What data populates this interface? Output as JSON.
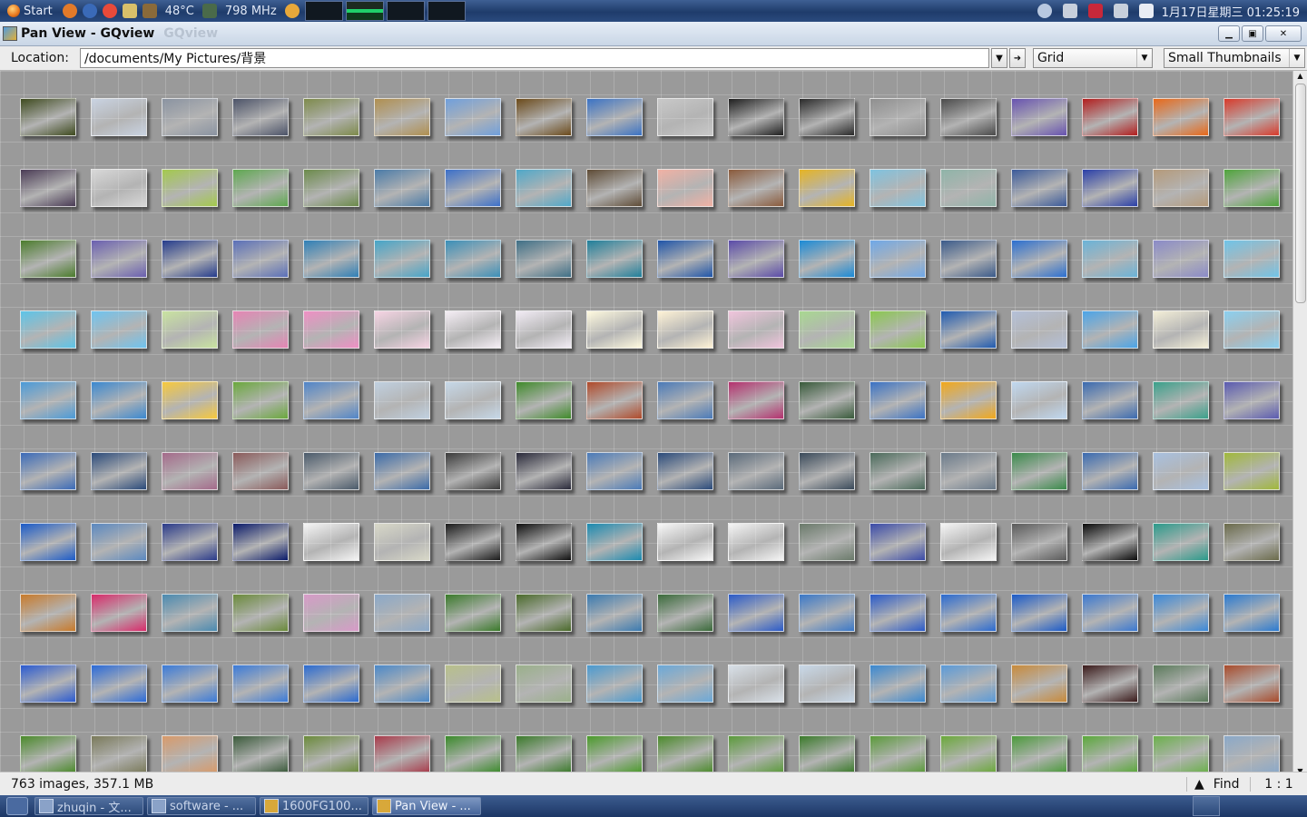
{
  "topbar": {
    "start_label": "Start",
    "temperature": "48°C",
    "cpu_freq": "798 MHz",
    "datetime": "1月17日星期三 01:25:19"
  },
  "window": {
    "title": "Pan View - GQview",
    "title_ghost": "GQview",
    "location_label": "Location:",
    "location_value": "/documents/My Pictures/背景",
    "layout_select": "Grid",
    "size_select": "Small Thumbnails"
  },
  "status": {
    "summary": "763 images, 357.1 MB",
    "find_label": "Find",
    "zoom": "1 : 1"
  },
  "taskbar": {
    "items": [
      {
        "label": "zhuqin - 文..."
      },
      {
        "label": "software - ..."
      },
      {
        "label": "1600FG100..."
      },
      {
        "label": "Pan View - ..."
      }
    ]
  },
  "colors": {
    "grid_background": "#9a9a9a",
    "taskbar": "#1c3665"
  },
  "thumbnails": [
    [
      "#3e4a1e",
      "#c9d3e2",
      "#8a93a1",
      "#4c5368",
      "#7d8a4a",
      "#b08f4f",
      "#6f9fdc",
      "#6b4a1a",
      "#3a72c4",
      "#c8c8c8",
      "#1e1e1e",
      "#2a2a2a",
      "#8f8f8f",
      "#4a4a4a",
      "#6752b0",
      "#b21d1d",
      "#e86818",
      "#d8392a"
    ],
    [
      "#4a3b55",
      "#d8d8d8",
      "#a3c94c",
      "#5ea84f",
      "#6b8a4a",
      "#4a7ba8",
      "#3b6fc9",
      "#4fa8c9",
      "#5e4b35",
      "#f1b1a4",
      "#8a5a3b",
      "#e6b423",
      "#7fc3e0",
      "#8fb4a8",
      "#3b5a9a",
      "#2a3fa8",
      "#b59a7a",
      "#4ea43a"
    ],
    [
      "#4b7c2c",
      "#6a5fb0",
      "#243b8c",
      "#5a6fb8",
      "#2e7fb6",
      "#45a5c8",
      "#3a8fb8",
      "#3e6f86",
      "#1f7f9a",
      "#1e54a8",
      "#5a4aa8",
      "#1a8ad6",
      "#6fa8e8",
      "#3a5a8a",
      "#2b6fd0",
      "#6ab3d8",
      "#8a8ac8",
      "#6fc4e8"
    ],
    [
      "#5cc4e8",
      "#6ec4f0",
      "#c9e3a0",
      "#e684b4",
      "#ef8fc4",
      "#f7d4e4",
      "#f5eef5",
      "#f2ecf5",
      "#fffadf",
      "#fff3d6",
      "#f0c4dc",
      "#a8d890",
      "#8ac84e",
      "#1f5ab0",
      "#b4c0d8",
      "#4aa4e8",
      "#f4efd8",
      "#8ad0f0"
    ],
    [
      "#4a9ad8",
      "#3a88d0",
      "#f7c93c",
      "#6aa83c",
      "#4f84c8",
      "#c0d0e0",
      "#c6d8e8",
      "#3f8a2a",
      "#b04a2a",
      "#4a7ab8",
      "#b4306e",
      "#385a3a",
      "#3a72c4",
      "#f2a81a",
      "#c0d8f0",
      "#3a6ab0",
      "#3aa08a",
      "#5a5ab0"
    ],
    [
      "#3a6ab8",
      "#2a4a7a",
      "#a46a8a",
      "#8a5a5a",
      "#4a5a6a",
      "#3a6aa8",
      "#3a3a3a",
      "#2a2a3a",
      "#4a7ab8",
      "#2a4a7a",
      "#5a6a7a",
      "#3a4a5a",
      "#4a6a5a",
      "#6a7a8a",
      "#3a8a4a",
      "#3a6ab0",
      "#a8c0e0",
      "#a0b83a"
    ],
    [
      "#1a5ac8",
      "#5a88c0",
      "#2a3a8a",
      "#0a1a6a",
      "#f5f5f5",
      "#d8d8c8",
      "#1a1a1a",
      "#0f0f0f",
      "#1a8ab0",
      "#f8f8f8",
      "#f5f5f5",
      "#6a7a6a",
      "#3a4aa8",
      "#f5f5f5",
      "#5a5a5a",
      "#0a0a0a",
      "#2a9a8a",
      "#6a6a4a"
    ],
    [
      "#c87a2a",
      "#d82a6a",
      "#4a8ab0",
      "#6a8a3a",
      "#d89ac8",
      "#8aa8c8",
      "#3a7a2a",
      "#4a6a2a",
      "#3a7ab0",
      "#3a6a3a",
      "#2a5ac8",
      "#3a78c8",
      "#2a5ac8",
      "#2a6ad0",
      "#1a5ac8",
      "#3a78d0",
      "#3a88d8",
      "#2a7ad0"
    ],
    [
      "#2a5ad0",
      "#2a6ad8",
      "#3a7ad8",
      "#3a7ad8",
      "#2a6ad0",
      "#4a88c8",
      "#b8c08a",
      "#9ab08a",
      "#4a9ad0",
      "#6aa8d8",
      "#d8e0e8",
      "#c8d8e8",
      "#3a88d0",
      "#5a9ad8",
      "#c88a3a",
      "#3a1a1a",
      "#5a7a5a",
      "#a84a2a"
    ],
    [
      "#4a8a2a",
      "#7a7a5a",
      "#d89a6a",
      "#3a5a3a",
      "#6a8a3a",
      "#a83a4a",
      "#3a8a2a",
      "#3a7a2a",
      "#4a9a2a",
      "#4a8a2a",
      "#5a9a3a",
      "#3a7a2a",
      "#5a9a3a",
      "#6aa83a",
      "#4a9a3a",
      "#5aa83a",
      "#6ab04a",
      "#8aa8c8"
    ]
  ]
}
